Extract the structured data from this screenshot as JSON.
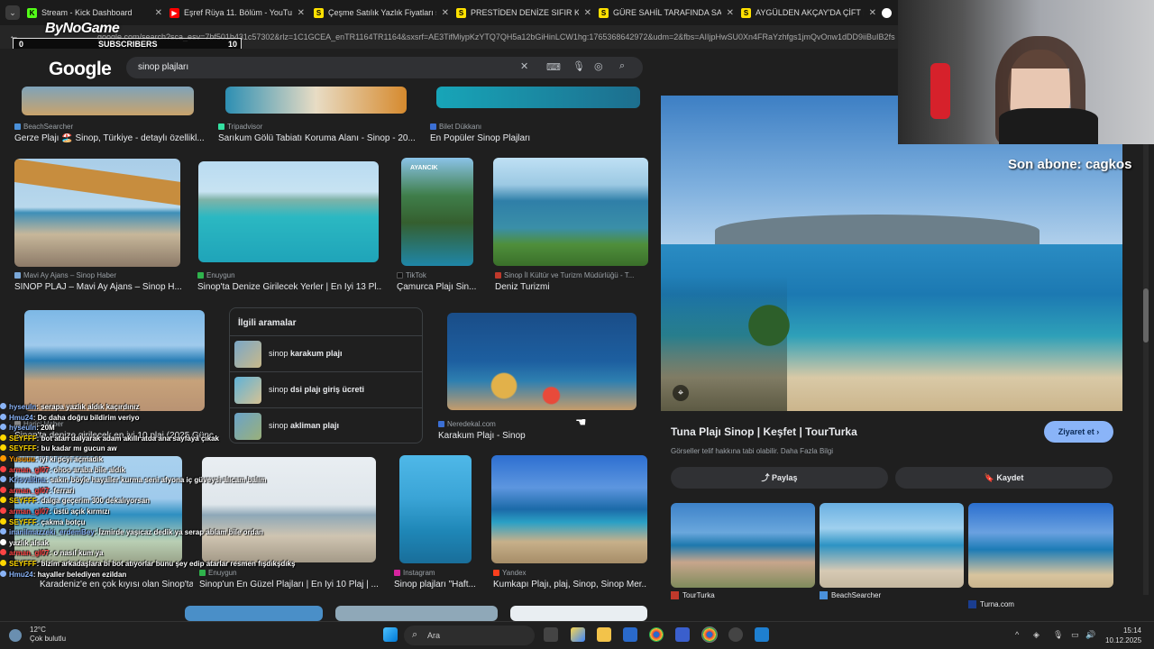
{
  "browser": {
    "tabs": [
      {
        "title": "Stream - Kick Dashboard",
        "color": "#53fc18",
        "glyph": "K"
      },
      {
        "title": "Eşref Rüya 11. Bölüm - YouTube",
        "color": "#ff0000",
        "glyph": "▶"
      },
      {
        "title": "Çeşme Satılık Yazlık Fiyatları sahi",
        "color": "#ffe100",
        "glyph": "S"
      },
      {
        "title": "PRESTİDEN DENİZE SIFIR KENDİ",
        "color": "#ffe100",
        "glyph": "S"
      },
      {
        "title": "GÜRE SAHİL TARAFINDA SATILIK",
        "color": "#ffe100",
        "glyph": "S"
      },
      {
        "title": "AYGÜLDEN AKÇAY'DA ÇİFT MU",
        "color": "#ffe100",
        "glyph": "S"
      }
    ],
    "url": "google.com/search?sca_esv=7bf501b431c57302&rlz=1C1GCEA_enTR1164TR1164&sxsrf=AE3TifMiypKzYTQ7QH5a12bGiHinLCW1hg:1765368642972&udm=2&fbs=AIIjpHwSU0Xn4FRaYzhfgs1jmQvOnw1dDD9iiBuIB2fs"
  },
  "overlay": {
    "logo": "ByNoGame",
    "subscribers_label": "SUBSCRIBERS",
    "sub_current": "0",
    "sub_goal": "10",
    "son_abone": "Son abone: cagkos"
  },
  "google": {
    "logo": "Google",
    "query": "sinop plajları"
  },
  "results": [
    {
      "source": "BeachSearcher",
      "title": "Gerze Plajı 🏖️ Sinop, Türkiye - detaylı özellikl...",
      "icon": "#4a90d9"
    },
    {
      "source": "Tripadvisor",
      "title": "Sarıkum Gölü Tabiatı Koruma Alanı - Sinop - 20...",
      "icon": "#34e0a1"
    },
    {
      "source": "Bilet Dükkanı",
      "title": "En Popüler Sinop Plajları",
      "icon": "#3b6fd4"
    },
    {
      "source": "Mavi Ay Ajans – Sinop Haber",
      "title": "SİNOP PLAJ – Mavi Ay Ajans – Sinop H...",
      "icon": "#7aa7d8"
    },
    {
      "source": "Enuygun",
      "title": "Sinop'ta Denize Girilecek Yerler | En İyi 13 Pl...",
      "icon": "#2fb24c"
    },
    {
      "source": "TikTok",
      "title": "Çamurca Plajı Sin...",
      "icon": "#111111"
    },
    {
      "source": "Sinop İl Kültür ve Turizm Müdürlüğü - T...",
      "title": "Deniz Turizmi",
      "icon": "#c0392b"
    },
    {
      "source": "Harici Haber",
      "title": "Sinop'ta denize girilecek en iyi 10 plaj (2025 Günc...",
      "icon": "#888888"
    },
    {
      "source": "Neredekal.com",
      "title": "Karakum Plajı - Sinop",
      "icon": "#3b6fd4"
    },
    {
      "source": "",
      "title": "Karadeniz'e en çok kıyısı olan Sinop'ta '...",
      "icon": "#888888"
    },
    {
      "source": "Enuygun",
      "title": "Sinop'un En Güzel Plajları | En İyi 10 Plaj | ...",
      "icon": "#2fb24c"
    },
    {
      "source": "Instagram",
      "title": "Sinop plajları \"Haft...",
      "icon": "#d6249f"
    },
    {
      "source": "Yandex",
      "title": "Kumkapı Plajı, plaj, Sinop, Sinop Mer...",
      "icon": "#fc3f1d"
    }
  ],
  "related": {
    "heading": "İlgili aramalar",
    "items": [
      {
        "prefix": "sinop ",
        "bold": "karakum plajı"
      },
      {
        "prefix": "sinop ",
        "bold": "dsi plajı giriş ücreti"
      },
      {
        "prefix": "sinop ",
        "bold": "akliman plajı"
      }
    ]
  },
  "preview": {
    "title": "Tuna Plajı Sinop | Keşfet | TourTurka",
    "note": "Görseller telif hakkına tabi olabilir. Daha Fazla Bilgi",
    "visit": "Ziyaret et",
    "share": "Paylaş",
    "save": "Kaydet",
    "similar": [
      {
        "source": "TourTurka",
        "icon": "#c0392b"
      },
      {
        "source": "BeachSearcher",
        "icon": "#4a90d9"
      },
      {
        "source": "Turna.com",
        "icon": "#1a3d8f"
      }
    ]
  },
  "chat": [
    {
      "user": "hyseuln",
      "msg": ": serapa yazlık aldık kaçırdınız",
      "color": "#8ab4f8"
    },
    {
      "user": "Hmu24",
      "msg": ": Dc daha doğru bildirim veriyo",
      "color": "#8ab4f8"
    },
    {
      "user": "hyseuln",
      "msg": ": 20M",
      "color": "#8ab4f8"
    },
    {
      "user": "SEYFFF",
      "msg": ": bot atan dalyarak adam akıllı atda ana sayfaya çıkak",
      "color": "#ffd700"
    },
    {
      "user": "SEYFFF",
      "msg": ": bu kadar mı gucun aw",
      "color": "#ffd700"
    },
    {
      "user": "Yusuuu",
      "msg": ": iyi ki pcyi açmadık",
      "color": "#ff9900"
    },
    {
      "user": "arman_gl07",
      "msg": ": ohoo araba bile aldık",
      "color": "#ff4444"
    },
    {
      "user": "Krisvaltina",
      "msg": ": sakın böyle hayaller kurma seni afyona iç güveysi alıcam balım",
      "color": "#8ab4f8"
    },
    {
      "user": "arman_gl07",
      "msg": ": ferrari",
      "color": "#ff4444"
    },
    {
      "user": "SEYFFF",
      "msg": ": dalga geçerim 300 dekalıyorsan",
      "color": "#ffd700"
    },
    {
      "user": "arman_gl07",
      "msg": ": üstü açık kırmızı",
      "color": "#ff4444"
    },
    {
      "user": "SEYFFF",
      "msg": ": çakma botçu",
      "color": "#ffd700"
    },
    {
      "user": "inanilmazzeki_erdemBey",
      "msg": ": İzmirde yaşıcaz dedik ya serap ablam bile ordan",
      "color": "#8ab4f8"
    },
    {
      "user": "yazlık alsak",
      "msg": "",
      "color": "#ffffff"
    },
    {
      "user": "arman_gl07",
      "msg": ": o nasıl kum ya",
      "color": "#ff4444"
    },
    {
      "user": "SEYFFF",
      "msg": ": bizim arkadaşlara bi bot atıyorlar bunu şey edip atarlar resmen fışdıkşdıkş",
      "color": "#ffd700"
    },
    {
      "user": "Hmu24",
      "msg": ": hayaller belediyen ezildan",
      "color": "#8ab4f8"
    }
  ],
  "taskbar": {
    "temp": "12°C",
    "weather": "Çok bulutlu",
    "search": "Ara",
    "time": "15:14",
    "date": "10.12.2025"
  }
}
